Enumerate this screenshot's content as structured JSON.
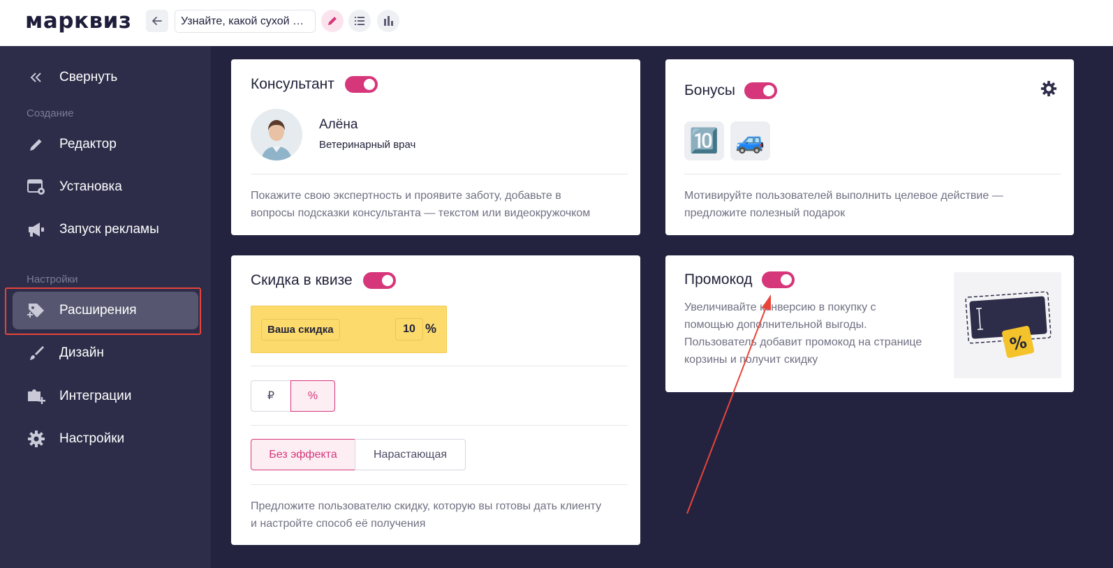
{
  "brand": {
    "logo": "марквиз",
    "accent": "#d6367a",
    "dark": "#232340"
  },
  "topbar": {
    "back_icon": "arrow-left-icon",
    "quiz_title": "Узнайте, какой сухой …",
    "edit_icon": "pencil-icon",
    "list_icon": "list-icon",
    "stats_icon": "bar-chart-icon"
  },
  "sidebar": {
    "collapse_label": "Свернуть",
    "section_create": "Создание",
    "section_settings": "Настройки",
    "items": [
      {
        "label": "Редактор",
        "icon": "pencil-icon"
      },
      {
        "label": "Установка",
        "icon": "install-window-icon"
      },
      {
        "label": "Запуск рекламы",
        "icon": "megaphone-icon"
      },
      {
        "label": "Расширения",
        "icon": "tag-plus-icon",
        "active": true
      },
      {
        "label": "Дизайн",
        "icon": "brush-icon"
      },
      {
        "label": "Интеграции",
        "icon": "puzzle-plus-icon"
      },
      {
        "label": "Настройки",
        "icon": "gear-icon"
      }
    ]
  },
  "consultant": {
    "title": "Консультант",
    "enabled": true,
    "name": "Алёна",
    "role": "Ветеринарный врач",
    "desc_line1": "Покажите свою экспертность и проявите заботу, добавьте в",
    "desc_line2": "вопросы подсказки консультанта — текстом или видеокружочком"
  },
  "bonuses": {
    "title": "Бонусы",
    "enabled": true,
    "tile1": "🔟",
    "tile2": "🚙",
    "desc_line1": "Мотивируйте пользователей выполнить целевое действие —",
    "desc_line2": "предложите полезный подарок"
  },
  "discount": {
    "title": "Скидка в квизе",
    "enabled": true,
    "label": "Ваша скидка",
    "value": "10",
    "unit": "%",
    "currency_options": [
      "₽",
      "%"
    ],
    "currency_selected": "%",
    "effect_options": [
      "Без эффекта",
      "Нарастающая"
    ],
    "effect_selected": "Без эффекта",
    "desc_line1": "Предложите пользователю скидку, которую вы готовы дать клиенту",
    "desc_line2": "и настройте способ её получения"
  },
  "promocode": {
    "title": "Промокод",
    "enabled": true,
    "desc_line1": "Увеличивайте конверсию в покупку с",
    "desc_line2": "помощью дополнительной выгоды.",
    "desc_line3": "Пользователь добавит промокод на странице",
    "desc_line4": "корзины и получит скидку",
    "badge": "%"
  }
}
